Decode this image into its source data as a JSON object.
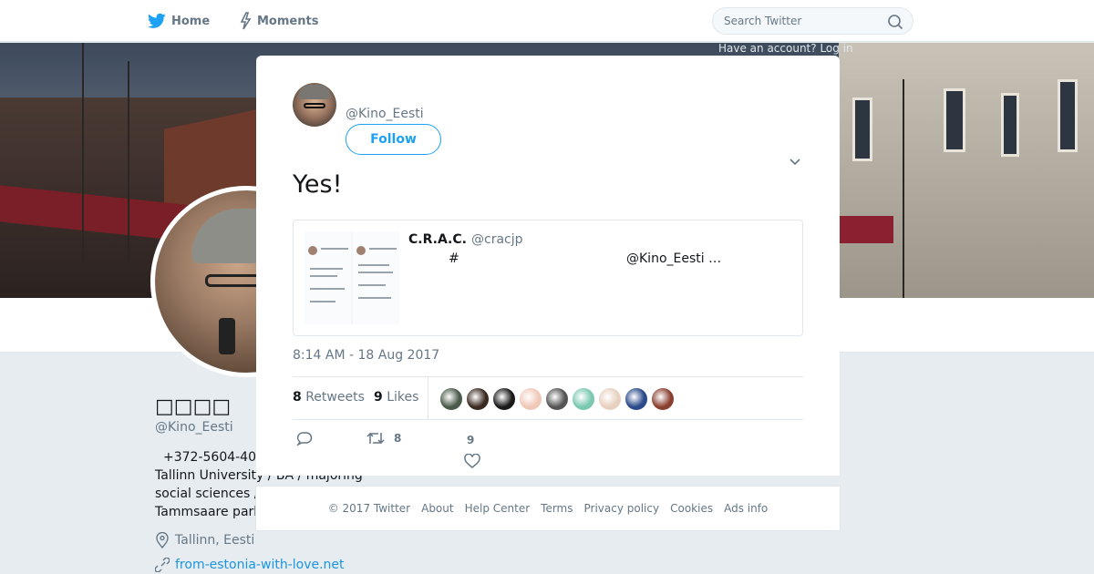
{
  "nav": {
    "home_label": "Home",
    "moments_label": "Moments",
    "search_placeholder": "Search Twitter",
    "login_hint": "Have an account? Log in"
  },
  "profile": {
    "display_name": "□□□□",
    "handle": "@Kino_Eesti",
    "bio_lines": [
      "+372-5604-40",
      "Tallinn University / BA / majoring",
      "social sciences /",
      "Tammsaare park"
    ],
    "location": "Tallinn, Eesti",
    "url": "from-estonia-with-love.net"
  },
  "tweet": {
    "author_handle": "@Kino_Eesti",
    "follow_label": "Follow",
    "text": "Yes!",
    "timestamp": "8:14 AM - 18 Aug 2017",
    "quote": {
      "name": "C.R.A.C.",
      "handle": "@cracjp",
      "hash": "#",
      "mention": "@Kino_Eesti …"
    },
    "retweets_count": "8",
    "retweets_label": "Retweets",
    "likes_count": "9",
    "likes_label": "Likes",
    "action_retweet_count": "8",
    "action_like_count": "9",
    "liker_colors": [
      "#4a5a4a",
      "#3a2a22",
      "#1a1a1a",
      "#f0c8b8",
      "#555555",
      "#7ac8b0",
      "#e8d0c0",
      "#2a4a8a",
      "#8a4030"
    ]
  },
  "footer": {
    "copyright": "© 2017 Twitter",
    "links": [
      "About",
      "Help Center",
      "Terms",
      "Privacy policy",
      "Cookies",
      "Ads info"
    ]
  },
  "colors": {
    "accent": "#1da1f2",
    "link": "#1b95e0",
    "muted": "#657786"
  }
}
